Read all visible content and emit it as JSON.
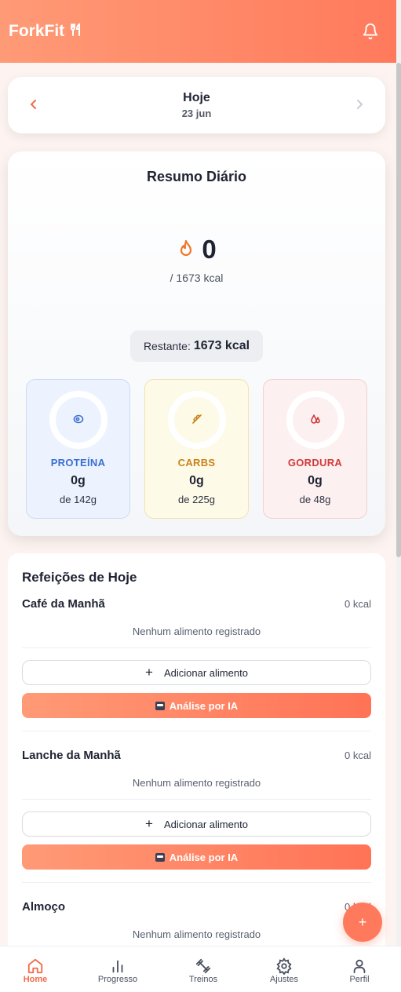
{
  "header": {
    "brand": "ForkFit",
    "brand_icon": "fork-knife-icon",
    "notification_icon": "bell-icon"
  },
  "date_nav": {
    "title": "Hoje",
    "date": "23 jun",
    "prev_icon": "chevron-left-icon",
    "next_icon": "chevron-right-icon"
  },
  "summary": {
    "title": "Resumo Diário",
    "calories_value": "0",
    "calories_goal": "/ 1673 kcal",
    "remaining_label": "Restante:",
    "remaining_value": "1673 kcal",
    "macros": [
      {
        "name": "PROTEÍNA",
        "value": "0g",
        "goal": "de 142g",
        "icon": "meat-icon",
        "color": "#3a6fd1",
        "progress": 0
      },
      {
        "name": "CARBS",
        "value": "0g",
        "goal": "de 225g",
        "icon": "wheat-icon",
        "color": "#c9821a",
        "progress": 0
      },
      {
        "name": "GORDURA",
        "value": "0g",
        "goal": "de 48g",
        "icon": "droplet-icon",
        "color": "#d23a3a",
        "progress": 0
      }
    ]
  },
  "meals": {
    "heading": "Refeições de Hoje",
    "items": [
      {
        "name": "Café da Manhã",
        "kcal": "0 kcal",
        "empty": "Nenhum alimento registrado",
        "add_label": "Adicionar alimento",
        "ai_label": "Análise por IA"
      },
      {
        "name": "Lanche da Manhã",
        "kcal": "0 kcal",
        "empty": "Nenhum alimento registrado",
        "add_label": "Adicionar alimento",
        "ai_label": "Análise por IA"
      },
      {
        "name": "Almoço",
        "kcal": "0 kcal",
        "empty": "Nenhum alimento registrado"
      }
    ]
  },
  "fab": {
    "label": "+"
  },
  "nav": [
    {
      "label": "Home",
      "icon": "home-icon",
      "active": true
    },
    {
      "label": "Progresso",
      "icon": "bar-chart-icon",
      "active": false
    },
    {
      "label": "Treinos",
      "icon": "dumbbell-icon",
      "active": false
    },
    {
      "label": "Ajustes",
      "icon": "gear-icon",
      "active": false
    },
    {
      "label": "Perfil",
      "icon": "user-icon",
      "active": false
    }
  ],
  "colors": {
    "accent": "#ff7a5c",
    "accent_light": "#ff9a76",
    "text": "#1f2433"
  }
}
